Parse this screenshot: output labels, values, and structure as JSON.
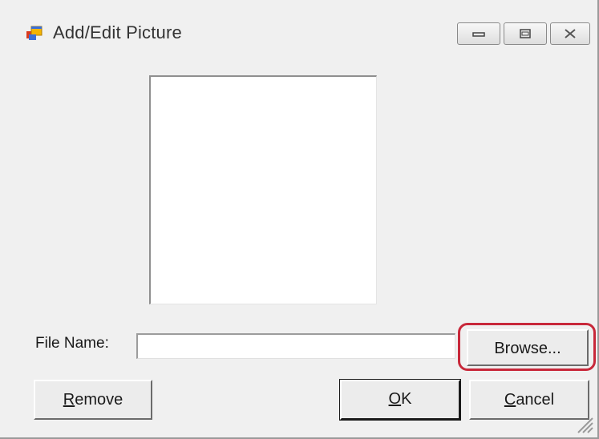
{
  "window": {
    "title": "Add/Edit Picture",
    "icon": "app-window-icon",
    "controls": {
      "minimize_icon": "minimize-icon",
      "maximize_icon": "maximize-icon",
      "close_icon": "close-icon"
    }
  },
  "form": {
    "file_name_label": "File Name:",
    "file_name_value": ""
  },
  "buttons": {
    "browse": "Browse...",
    "remove_mnemonic": "R",
    "remove_rest": "emove",
    "ok_mnemonic": "O",
    "ok_rest": "K",
    "cancel_mnemonic": "C",
    "cancel_rest": "ancel"
  },
  "colors": {
    "window_bg": "#f0f0f0",
    "highlight": "#c8283a"
  }
}
